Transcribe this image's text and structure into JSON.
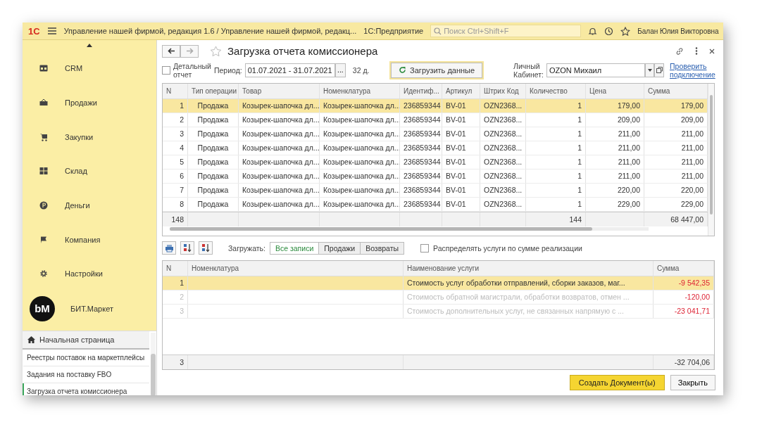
{
  "window": {
    "logo": "1С",
    "title": "Управление нашей фирмой, редакция 1.6 / Управление нашей фирмой, редакц...",
    "app_name": "1С:Предприятие",
    "search_placeholder": "Поиск Ctrl+Shift+F",
    "user": "Балан Юлия Викторовна"
  },
  "sidebar": {
    "sections": [
      {
        "label": "CRM",
        "kind": "crm"
      },
      {
        "label": "Продажи",
        "kind": "sales"
      },
      {
        "label": "Закупки",
        "kind": "purchases"
      },
      {
        "label": "Склад",
        "kind": "warehouse"
      },
      {
        "label": "Деньги",
        "kind": "money"
      },
      {
        "label": "Компания",
        "kind": "company"
      },
      {
        "label": "Настройки",
        "kind": "settings"
      }
    ],
    "brand": {
      "label": "БИТ.Маркет",
      "logo_text": "bM"
    },
    "home": {
      "label": "Начальная страница"
    },
    "open_items": [
      {
        "label": "Реестры поставок на маркетплейсы",
        "selected": false
      },
      {
        "label": "Задания на поставку FBO",
        "selected": false
      },
      {
        "label": "Загрузка отчета комиссионера",
        "selected": true
      }
    ]
  },
  "form": {
    "title": "Загрузка отчета комиссионера",
    "detailed": {
      "label": "Детальный отчет",
      "checked": false
    },
    "period": {
      "label": "Период:",
      "value": "01.07.2021 - 31.07.2021",
      "select_button": "...",
      "days": "32 д."
    },
    "load_button": "Загрузить данные",
    "cabinet": {
      "label": "Личный Кабинет:",
      "value": "OZON Михаил"
    },
    "check_link": "Проверить подключение"
  },
  "table": {
    "columns": [
      "N",
      "Тип операции",
      "Товар",
      "Номенклатура",
      "Идентиф...",
      "Артикул",
      "Штрих Код",
      "Количество",
      "Цена",
      "Сумма"
    ],
    "rows": [
      {
        "cells": [
          "1",
          "Продажа",
          "Козырек-шапочка дл...",
          "Козырек-шапочка дл...",
          "236859344",
          "BV-01",
          "OZN2368...",
          "1",
          "179,00",
          "179,00"
        ],
        "selected": true
      },
      {
        "cells": [
          "2",
          "Продажа",
          "Козырек-шапочка дл...",
          "Козырек-шапочка дл...",
          "236859344",
          "BV-01",
          "OZN2368...",
          "1",
          "209,00",
          "209,00"
        ],
        "selected": false
      },
      {
        "cells": [
          "3",
          "Продажа",
          "Козырек-шапочка дл...",
          "Козырек-шапочка дл...",
          "236859344",
          "BV-01",
          "OZN2368...",
          "1",
          "211,00",
          "211,00"
        ],
        "selected": false
      },
      {
        "cells": [
          "4",
          "Продажа",
          "Козырек-шапочка дл...",
          "Козырек-шапочка дл...",
          "236859344",
          "BV-01",
          "OZN2368...",
          "1",
          "211,00",
          "211,00"
        ],
        "selected": false
      },
      {
        "cells": [
          "5",
          "Продажа",
          "Козырек-шапочка дл...",
          "Козырек-шапочка дл...",
          "236859344",
          "BV-01",
          "OZN2368...",
          "1",
          "211,00",
          "211,00"
        ],
        "selected": false
      },
      {
        "cells": [
          "6",
          "Продажа",
          "Козырек-шапочка дл...",
          "Козырек-шапочка дл...",
          "236859344",
          "BV-01",
          "OZN2368...",
          "1",
          "211,00",
          "211,00"
        ],
        "selected": false
      },
      {
        "cells": [
          "7",
          "Продажа",
          "Козырек-шапочка дл...",
          "Козырек-шапочка дл...",
          "236859344",
          "BV-01",
          "OZN2368...",
          "1",
          "220,00",
          "220,00"
        ],
        "selected": false
      },
      {
        "cells": [
          "8",
          "Продажа",
          "Козырек-шапочка дл...",
          "Козырек-шапочка дл...",
          "236859344",
          "BV-01",
          "OZN2368...",
          "1",
          "229,00",
          "229,00"
        ],
        "selected": false
      }
    ],
    "footer": {
      "count": "148",
      "quantity": "144",
      "sum": "68 447,00"
    }
  },
  "toolbar": {
    "load_label": "Загружать:",
    "filters": [
      {
        "label": "Все записи",
        "selected": true
      },
      {
        "label": "Продажи",
        "selected": false
      },
      {
        "label": "Возвраты",
        "selected": false
      }
    ],
    "distribute": {
      "label": "Распределять услуги по сумме реализации",
      "checked": false
    }
  },
  "services": {
    "columns": [
      "N",
      "Номенклатура",
      "Наименование услуги",
      "Сумма"
    ],
    "rows": [
      {
        "n": "1",
        "service": "Стоимость услуг обработки отправлений, сборки заказов, маг...",
        "sum": "-9 542,35",
        "selected": true,
        "disabled": false
      },
      {
        "n": "2",
        "service": "Стоимость обратной магистрали, обработки возвратов, отмен ...",
        "sum": "-120,00",
        "selected": false,
        "disabled": true
      },
      {
        "n": "3",
        "service": "Стоимость дополнительных услуг, не связанных напрямую с ...",
        "sum": "-23 041,71",
        "selected": false,
        "disabled": true
      }
    ],
    "footer": {
      "n": "3",
      "sum": "-32 704,06"
    }
  },
  "buttons": {
    "create": "Создать Документ(ы)",
    "close": "Закрыть"
  }
}
